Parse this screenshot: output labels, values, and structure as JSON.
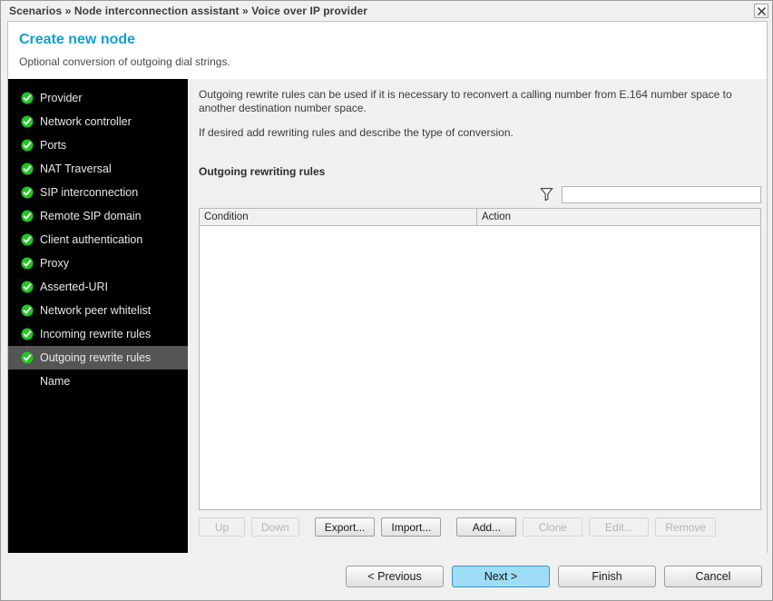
{
  "window": {
    "breadcrumb": "Scenarios » Node interconnection assistant » Voice over IP provider",
    "close_icon": "close-icon"
  },
  "panel": {
    "title": "Create new node",
    "subtitle": "Optional conversion of outgoing dial strings.",
    "title_color": "#0fa0ce"
  },
  "sidebar": {
    "items": [
      {
        "label": "Provider",
        "completed": true,
        "active": false
      },
      {
        "label": "Network controller",
        "completed": true,
        "active": false
      },
      {
        "label": "Ports",
        "completed": true,
        "active": false
      },
      {
        "label": "NAT Traversal",
        "completed": true,
        "active": false
      },
      {
        "label": "SIP interconnection",
        "completed": true,
        "active": false
      },
      {
        "label": "Remote SIP domain",
        "completed": true,
        "active": false
      },
      {
        "label": "Client authentication",
        "completed": true,
        "active": false
      },
      {
        "label": "Proxy",
        "completed": true,
        "active": false
      },
      {
        "label": "Asserted-URI",
        "completed": true,
        "active": false
      },
      {
        "label": "Network peer whitelist",
        "completed": true,
        "active": false
      },
      {
        "label": "Incoming rewrite rules",
        "completed": true,
        "active": false
      },
      {
        "label": "Outgoing rewrite rules",
        "completed": true,
        "active": true
      },
      {
        "label": "Name",
        "completed": false,
        "active": false
      }
    ],
    "check_color": "#22c521"
  },
  "content": {
    "paragraph1": "Outgoing rewrite rules can be used if it is necessary to reconvert a calling number from E.164 number space to another destination number space.",
    "paragraph2": "If desired add rewriting rules and describe the type of conversion.",
    "section_label": "Outgoing rewriting rules",
    "filter": {
      "icon": "filter-funnel-icon",
      "value": "",
      "placeholder": ""
    },
    "table": {
      "columns": [
        "Condition",
        "Action"
      ],
      "rows": []
    },
    "toolbar": [
      {
        "label": "Up",
        "enabled": false
      },
      {
        "label": "Down",
        "enabled": false
      },
      {
        "label": "Export...",
        "enabled": true
      },
      {
        "label": "Import...",
        "enabled": true
      },
      {
        "label": "Add...",
        "enabled": true
      },
      {
        "label": "Clone",
        "enabled": false
      },
      {
        "label": "Edit...",
        "enabled": false
      },
      {
        "label": "Remove",
        "enabled": false
      }
    ]
  },
  "footer": {
    "previous": "< Previous",
    "next": "Next >",
    "finish": "Finish",
    "cancel": "Cancel",
    "next_bg": "#9eddf5"
  }
}
